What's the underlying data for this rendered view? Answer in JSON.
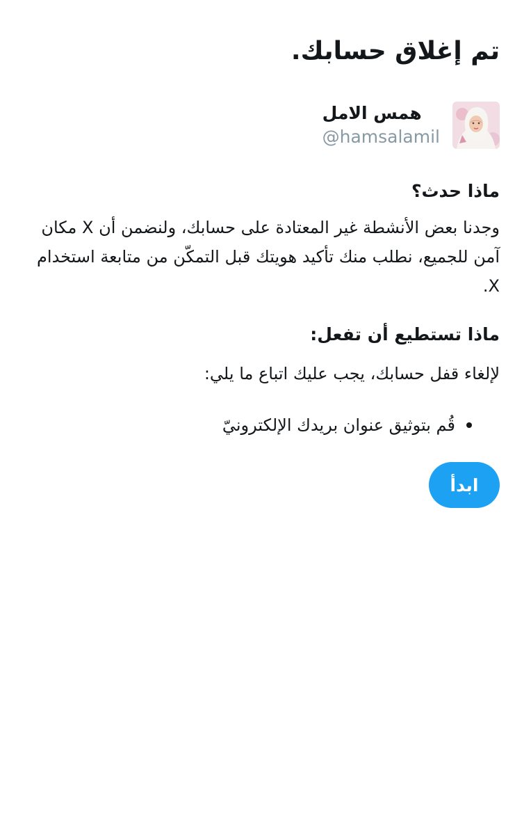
{
  "page": {
    "title": "تم إغلاق حسابك."
  },
  "profile": {
    "display_name": "همس الامل",
    "handle": "@hamsalamil",
    "avatar_icon": "user-avatar-photo"
  },
  "what_happened": {
    "heading": "ماذا حدث؟",
    "body": "وجدنا بعض الأنشطة غير المعتادة على حسابك، ولنضمن أن X مكان آمن للجميع، نطلب منك تأكيد هويتك قبل التمكّن من متابعة استخدام X."
  },
  "what_you_can_do": {
    "heading": "ماذا تستطيع أن تفعل:",
    "intro": "لإلغاء قفل حسابك، يجب عليك اتباع ما يلي:",
    "steps": [
      "قُم بتوثيق عنوان بريدك الإلكترونيّ"
    ]
  },
  "actions": {
    "start_label": "ابدأ"
  },
  "colors": {
    "accent": "#1da1f2",
    "text": "#14171a",
    "muted": "#8899a6"
  }
}
